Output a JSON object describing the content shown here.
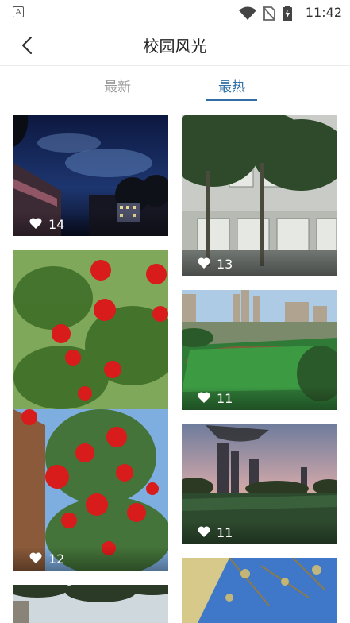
{
  "status_bar": {
    "time": "11:42",
    "app_badge": "A"
  },
  "header": {
    "title": "校园风光"
  },
  "tabs": [
    {
      "label": "最新",
      "active": false
    },
    {
      "label": "最热",
      "active": true
    }
  ],
  "photos": [
    {
      "likes": "14",
      "scene": "night-sky"
    },
    {
      "likes": "13",
      "scene": "palm-building"
    },
    {
      "likes": "12",
      "scene": "red-roses"
    },
    {
      "likes": "11",
      "scene": "sports-field"
    },
    {
      "likes": "11",
      "scene": "sunset-field"
    },
    {
      "likes": "",
      "scene": "trees-bottom"
    },
    {
      "likes": "",
      "scene": "blue-court-bottom"
    }
  ],
  "colors": {
    "accent": "#2f6fa6",
    "tab_inactive": "#9a9a9a"
  }
}
